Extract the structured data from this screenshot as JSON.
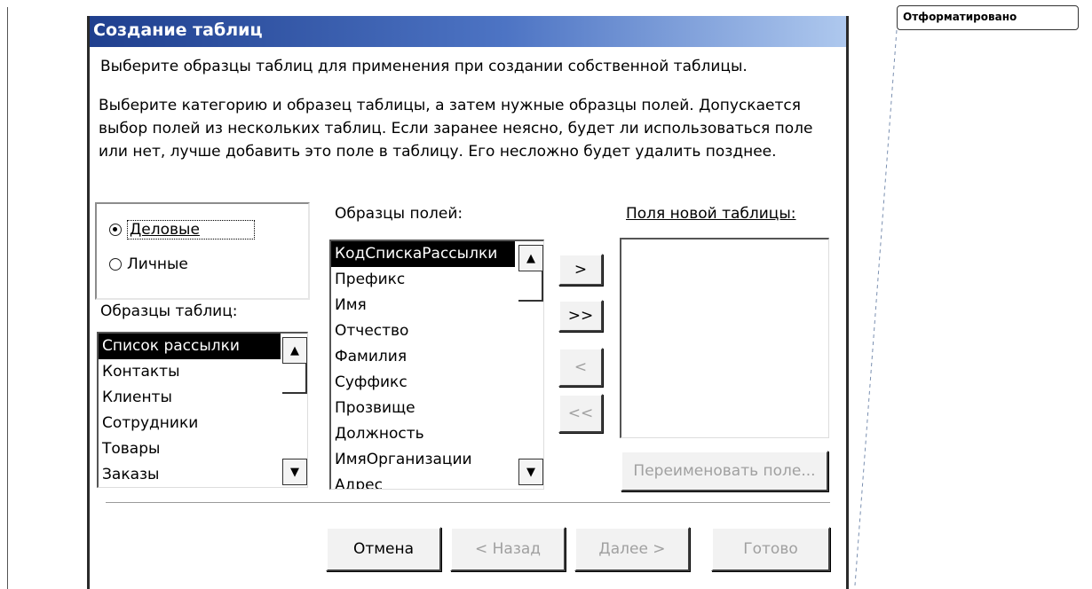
{
  "dialog": {
    "title": "Создание таблиц",
    "intro": "Выберите образцы таблиц для применения при создании собственной таблицы.",
    "instructions": "Выберите категорию и образец таблицы, а затем нужные образцы полей. Допускается\nвыбор полей из нескольких таблиц. Если заранее неясно, будет ли использоваться поле\nили нет, лучше добавить это поле в таблицу. Его несложно будет удалить позднее."
  },
  "category": {
    "options": [
      "Деловые",
      "Личные"
    ],
    "selected": "Деловые"
  },
  "sample_tables": {
    "label": "Образцы таблиц:",
    "items": [
      "Список рассылки",
      "Контакты",
      "Клиенты",
      "Сотрудники",
      "Товары",
      "Заказы"
    ],
    "selected": "Список рассылки"
  },
  "sample_fields": {
    "label": "Образцы полей:",
    "items": [
      "КодСпискаРассылки",
      "Префикс",
      "Имя",
      "Отчество",
      "Фамилия",
      "Суффикс",
      "Прозвище",
      "Должность",
      "ИмяОрганизации",
      "Адрес"
    ],
    "selected": "КодСпискаРассылки"
  },
  "move_buttons": {
    "add_one": ">",
    "add_all": ">>",
    "remove_one": "<",
    "remove_all": "<<"
  },
  "new_fields": {
    "label": "Поля новой таблицы:",
    "items": [],
    "rename_button": "Переименовать поле..."
  },
  "footer": {
    "cancel": "Отмена",
    "back": "< Назад",
    "next": "Далее >",
    "finish": "Готово"
  },
  "comment_sidebar": {
    "label": "Отформатировано"
  }
}
